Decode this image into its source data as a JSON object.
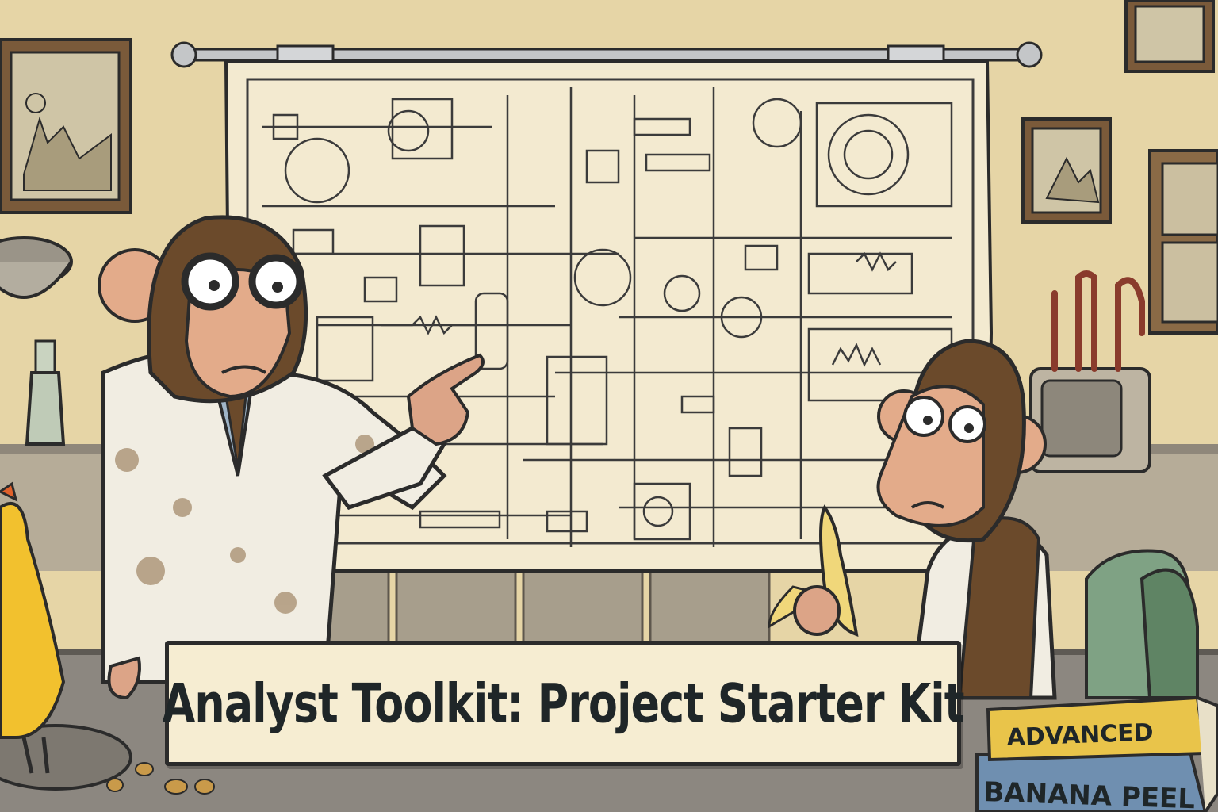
{
  "banner": {
    "title": "Analyst Toolkit: Project Starter Kit"
  },
  "books": {
    "top_label": "ADVANCED",
    "bottom_label": "BANANA PEEL"
  },
  "colors": {
    "wall": "#e6d5a6",
    "paper": "#f3ead0",
    "ink": "#2b2b2b",
    "lab_coat": "#f1ede2",
    "monkey_fur": "#6b4a2b",
    "monkey_face": "#e3ab8a",
    "banner_bg": "#f6edd2",
    "book_yellow": "#e9c44a",
    "book_blue": "#6f8fb0",
    "counter": "#8a8680",
    "chicken": "#f2c12e"
  },
  "icons": [
    "schematic-poster",
    "monkey-scientist",
    "monkey-with-banana",
    "chicken",
    "books",
    "framed-picture",
    "flask",
    "colander",
    "vintage-device"
  ]
}
